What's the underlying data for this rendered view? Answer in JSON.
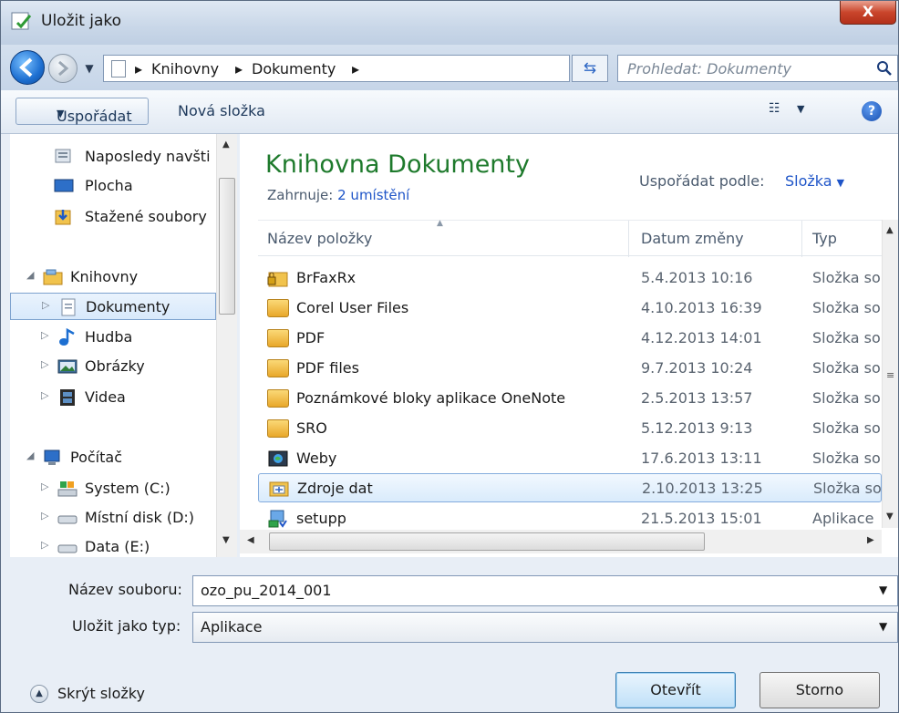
{
  "window": {
    "title": "Uložit jako",
    "close_label": "X"
  },
  "nav": {
    "breadcrumbs": [
      "Knihovny",
      "Dokumenty"
    ],
    "search_placeholder": "Prohledat: Dokumenty"
  },
  "toolbar": {
    "organize": "Uspořádat",
    "new_folder": "Nová složka"
  },
  "tree": {
    "items": [
      {
        "label": "Naposledy navšti",
        "icon": "recent-places-icon"
      },
      {
        "label": "Plocha",
        "icon": "desktop-icon"
      },
      {
        "label": "Stažené soubory",
        "icon": "downloads-icon"
      },
      {
        "label": "Knihovny",
        "icon": "libraries-icon"
      },
      {
        "label": "Dokumenty",
        "icon": "documents-icon"
      },
      {
        "label": "Hudba",
        "icon": "music-icon"
      },
      {
        "label": "Obrázky",
        "icon": "pictures-icon"
      },
      {
        "label": "Videa",
        "icon": "videos-icon"
      },
      {
        "label": "Počítač",
        "icon": "computer-icon"
      },
      {
        "label": "System (C:)",
        "icon": "system-drive-icon"
      },
      {
        "label": "Místní disk (D:)",
        "icon": "local-disk-icon"
      },
      {
        "label": "Data (E:)",
        "icon": "data-drive-icon"
      }
    ]
  },
  "library": {
    "title": "Knihovna Dokumenty",
    "includes_label": "Zahrnuje:",
    "includes_link": "2 umístění",
    "arrange_label": "Uspořádat podle:",
    "arrange_value": "Složka"
  },
  "columns": {
    "name": "Název položky",
    "date": "Datum změny",
    "type": "Typ"
  },
  "files": [
    {
      "name": "BrFaxRx",
      "date": "5.4.2013 10:16",
      "type": "Složka so",
      "icon": "locked-folder-icon"
    },
    {
      "name": "Corel User Files",
      "date": "4.10.2013 16:39",
      "type": "Složka so",
      "icon": "folder-icon"
    },
    {
      "name": "PDF",
      "date": "4.12.2013 14:01",
      "type": "Složka so",
      "icon": "folder-icon"
    },
    {
      "name": "PDF files",
      "date": "9.7.2013 10:24",
      "type": "Složka so",
      "icon": "folder-icon"
    },
    {
      "name": "Poznámkové bloky aplikace OneNote",
      "date": "2.5.2013 13:57",
      "type": "Složka so",
      "icon": "folder-icon"
    },
    {
      "name": "SRO",
      "date": "5.12.2013 9:13",
      "type": "Složka so",
      "icon": "folder-icon"
    },
    {
      "name": "Weby",
      "date": "17.6.2013 13:11",
      "type": "Složka so",
      "icon": "web-folder-icon"
    },
    {
      "name": "Zdroje dat",
      "date": "2.10.2013 13:25",
      "type": "Složka so",
      "icon": "data-sources-icon"
    },
    {
      "name": "setupp",
      "date": "21.5.2013 15:01",
      "type": "Aplikace",
      "icon": "setup-app-icon"
    }
  ],
  "form": {
    "filename_label": "Název souboru:",
    "filename_value": "ozo_pu_2014_001",
    "filetype_label": "Uložit jako typ:",
    "filetype_value": "Aplikace"
  },
  "footer": {
    "hide_folders": "Skrýt složky",
    "open_button": "Otevřít",
    "cancel_button": "Storno"
  },
  "colors": {
    "library_title": "#1e7a2c",
    "link": "#1f55c8",
    "selection": "#84acdd"
  }
}
